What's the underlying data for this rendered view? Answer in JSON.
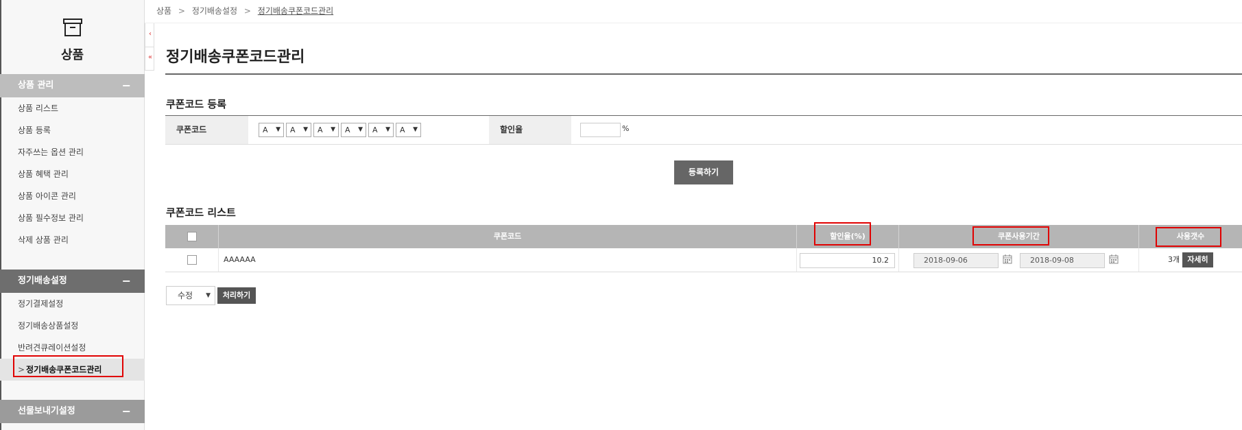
{
  "breadcrumb": {
    "items": [
      "상품",
      "정기배송설정",
      "정기배송쿠폰코드관리"
    ],
    "sep": ">"
  },
  "sidebar": {
    "title": "상품",
    "groups": [
      {
        "label": "상품 관리",
        "toggle": "−",
        "items": [
          "상품 리스트",
          "상품 등록",
          "자주쓰는 옵션 관리",
          "상품 혜택 관리",
          "상품 아이콘 관리",
          "상품 필수정보 관리",
          "삭제 상품 관리"
        ]
      },
      {
        "label": "정기배송설정",
        "toggle": "−",
        "items": [
          "정기결제설정",
          "정기배송상품설정",
          "반려견큐레이션설정",
          "정기배송쿠폰코드관리"
        ],
        "active_index": 3,
        "active_arrow": ">"
      },
      {
        "label": "선물보내기설정",
        "toggle": "−"
      }
    ]
  },
  "collapse": {
    "left": "‹",
    "up": "«"
  },
  "page": {
    "title": "정기배송쿠폰코드관리"
  },
  "register": {
    "title": "쿠폰코드 등록",
    "code_label": "쿠폰코드",
    "code_selects": [
      "A",
      "A",
      "A",
      "A",
      "A",
      "A"
    ],
    "rate_label": "할인율",
    "rate_value": "",
    "rate_unit": "%",
    "submit_label": "등록하기"
  },
  "list": {
    "title": "쿠폰코드 리스트",
    "columns": [
      "",
      "쿠폰코드",
      "할인율(%)",
      "쿠폰사용기간",
      "사용갯수"
    ],
    "rows": [
      {
        "checked": false,
        "code": "AAAAAA",
        "rate": "10.2",
        "start": "2018-09-06",
        "end": "2018-09-08",
        "count": "3개",
        "detail_label": "자세히"
      }
    ],
    "action_select": "수정",
    "action_button": "처리하기"
  },
  "colors": {
    "highlight": "#e00000",
    "sidebar_group_active": "#6e6e6e",
    "header_gray": "#b5b5b5"
  }
}
